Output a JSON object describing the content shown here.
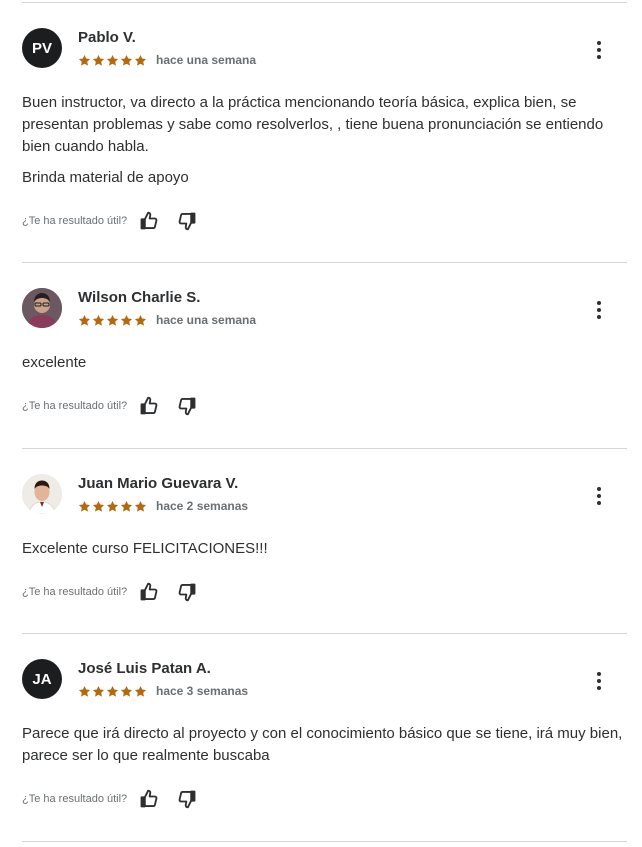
{
  "colors": {
    "star": "#b4690e",
    "text": "#2d2f31",
    "muted": "#6a6f73",
    "divider": "#d1d7dc"
  },
  "helpful_question": "¿Te ha resultado útil?",
  "reviews": [
    {
      "name": "Pablo V.",
      "initials": "PV",
      "rating": 5,
      "time": "hace una semana",
      "paragraphs": [
        "Buen instructor, va directo a la práctica mencionando teoría básica, explica bien, se presentan problemas y sabe como resolverlos, , tiene buena pronunciación se entiendo bien cuando habla.",
        "Brinda material de apoyo"
      ]
    },
    {
      "name": "Wilson Charlie S.",
      "initials": "",
      "rating": 5,
      "time": "hace una semana",
      "paragraphs": [
        "excelente"
      ]
    },
    {
      "name": "Juan Mario Guevara V.",
      "initials": "",
      "rating": 5,
      "time": "hace 2 semanas",
      "paragraphs": [
        "Excelente curso FELICITACIONES!!!"
      ]
    },
    {
      "name": "José Luis Patan A.",
      "initials": "JA",
      "rating": 5,
      "time": "hace 3 semanas",
      "paragraphs": [
        "Parece que irá directo al proyecto y con el conocimiento básico que se tiene, irá muy bien, parece ser lo que realmente buscaba"
      ]
    }
  ]
}
